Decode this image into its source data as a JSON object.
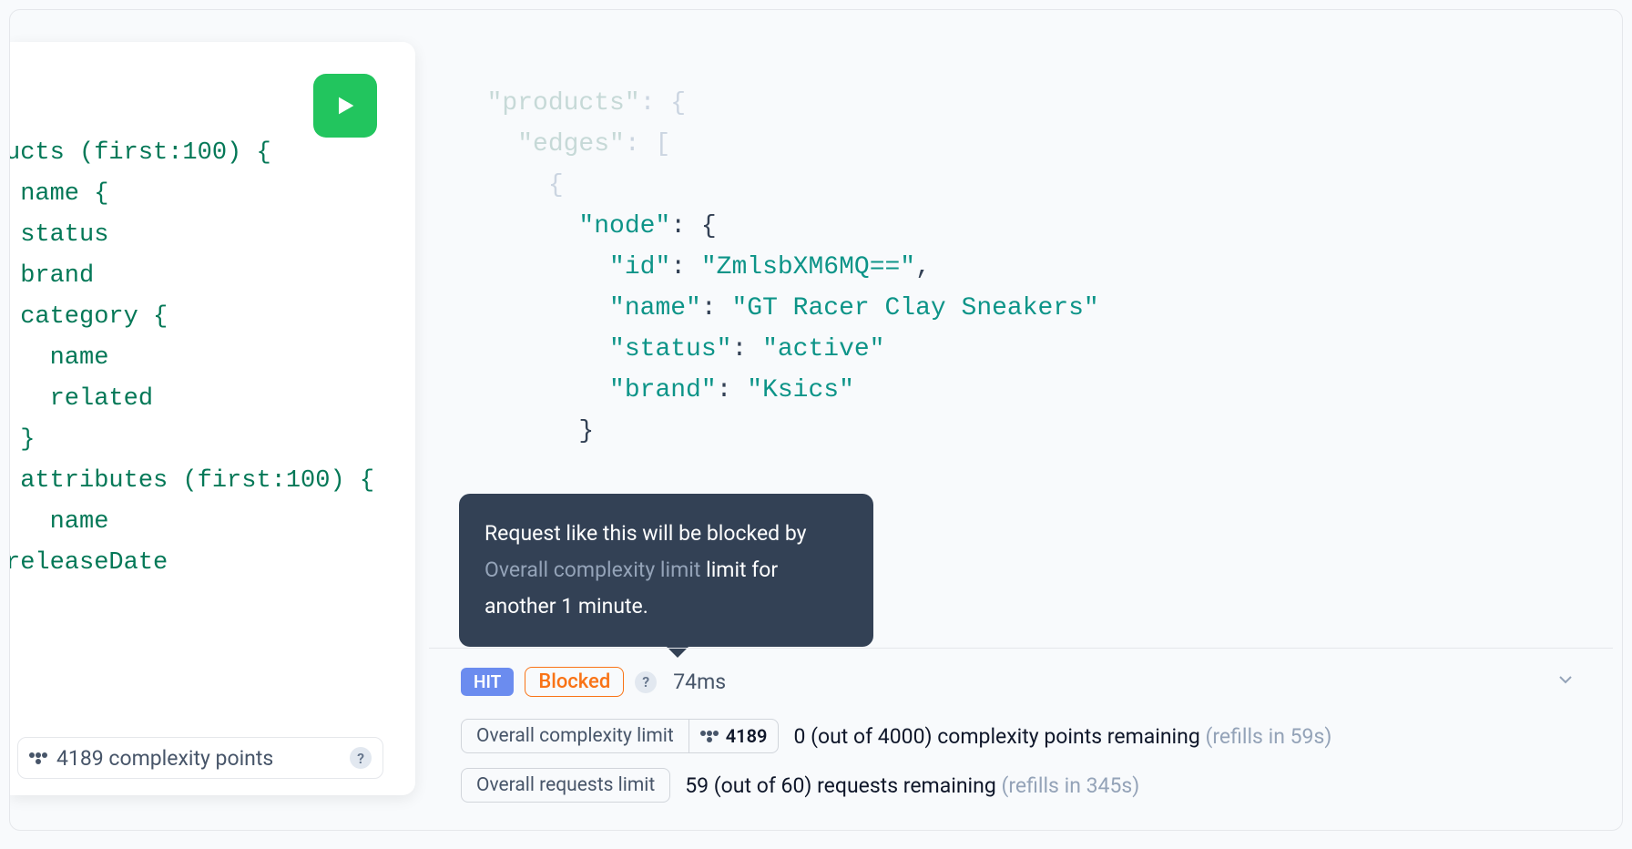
{
  "editor": {
    "lines": [
      "ucts (first:100) {",
      " name {",
      " status",
      " brand",
      " category {",
      "   name",
      "   related",
      " }",
      " attributes (first:100) {",
      "   name",
      "releaseDate"
    ],
    "footer": {
      "points": "4189 complexity points",
      "help": "?"
    }
  },
  "response": {
    "lines": {
      "l1_key": "\"products\"",
      "l2_key": "\"edges\"",
      "l4_key": "\"node\"",
      "l5_key": "\"id\"",
      "l5_val": "\"ZmlsbXM6MQ==\"",
      "l6_key": "\"name\"",
      "l6_val": "\"GT Racer Clay Sneakers\"",
      "l7_key": "\"status\"",
      "l7_val": "\"active\"",
      "l8_key": "\"brand\"",
      "l8_val": "\"Ksics\""
    }
  },
  "tooltip": {
    "part1": "Request like this will be blocked by ",
    "part2": "Overall complexity limit",
    "part3": " limit for another 1 minute."
  },
  "status": {
    "hit": "HIT",
    "blocked": "Blocked",
    "help": "?",
    "timing": "74ms",
    "complexity": {
      "label": "Overall complexity limit",
      "value": "4189",
      "text": "0 (out of 4000) complexity points remaining ",
      "refill": "(refills in 59s)"
    },
    "requests": {
      "label": "Overall requests limit",
      "text": "59 (out of 60) requests remaining ",
      "refill": "(refills in 345s)"
    }
  }
}
